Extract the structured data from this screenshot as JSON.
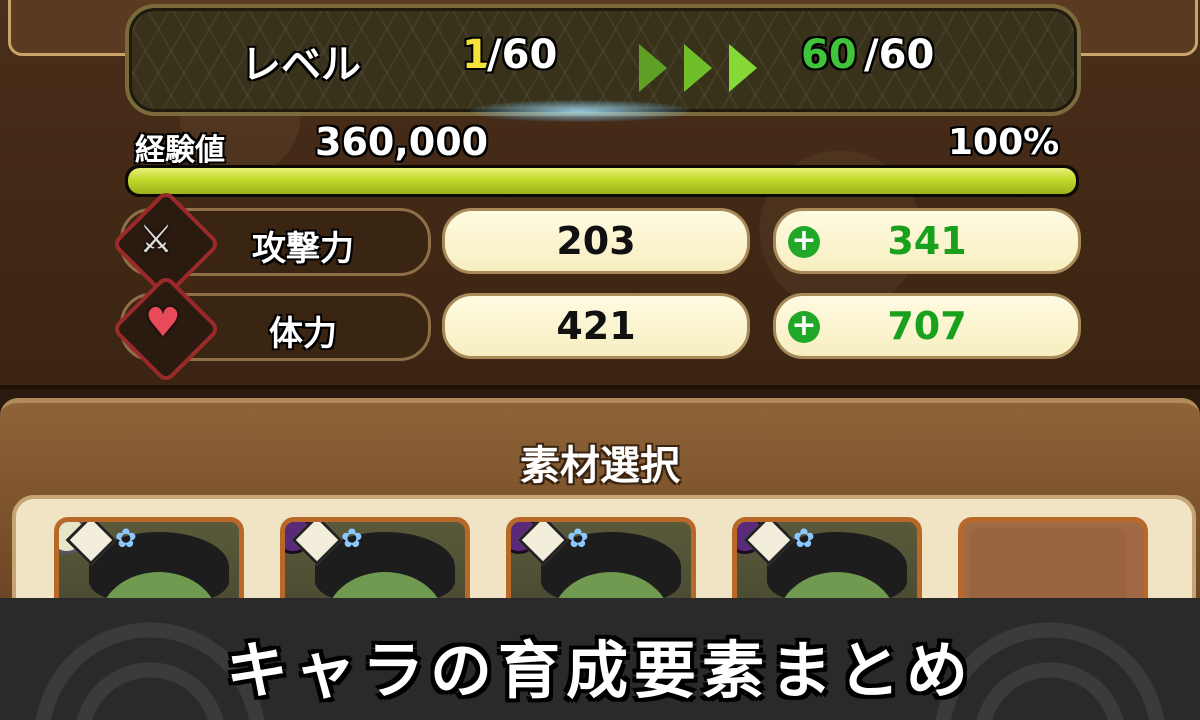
{
  "level": {
    "label": "レベル",
    "current": "1",
    "current_max": "/60",
    "target": "60",
    "target_max": "/60"
  },
  "experience": {
    "label": "経験値",
    "value": "360,000",
    "percent_text": "100%",
    "fill_fraction": 1.0
  },
  "stats": [
    {
      "label": "攻撃力",
      "icon": "crossed-swords-icon",
      "base": "203",
      "bonus": "341"
    },
    {
      "label": "体力",
      "icon": "heart-icon",
      "base": "421",
      "bonus": "707"
    }
  ],
  "materials": {
    "title": "素材選択",
    "slots_filled": 4,
    "slots_empty": 1
  },
  "banner": {
    "text": "キャラの育成要素まとめ"
  },
  "colors": {
    "level_current": "#f5e23a",
    "level_target": "#3fc43a",
    "arrow": "#6fbf2a",
    "exp_fill": "#c2d82a",
    "bonus_text": "#19a11e"
  }
}
